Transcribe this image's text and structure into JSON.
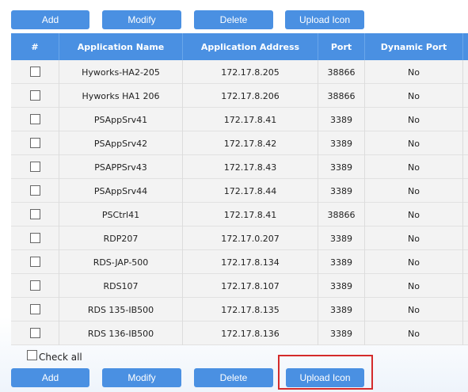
{
  "toolbar_top": {
    "add": "Add",
    "modify": "Modify",
    "delete": "Delete",
    "upload": "Upload Icon"
  },
  "toolbar_bottom": {
    "add": "Add",
    "modify": "Modify",
    "delete": "Delete",
    "upload": "Upload Icon"
  },
  "table": {
    "headers": [
      "#",
      "Application Name",
      "Application Address",
      "Port",
      "Dynamic Port"
    ],
    "rows": [
      [
        "Hyworks-HA2-205",
        "172.17.8.205",
        "38866",
        "No"
      ],
      [
        "Hyworks HA1 206",
        "172.17.8.206",
        "38866",
        "No"
      ],
      [
        "PSAppSrv41",
        "172.17.8.41",
        "3389",
        "No"
      ],
      [
        "PSAppSrv42",
        "172.17.8.42",
        "3389",
        "No"
      ],
      [
        "PSAPPSrv43",
        "172.17.8.43",
        "3389",
        "No"
      ],
      [
        "PSAppSrv44",
        "172.17.8.44",
        "3389",
        "No"
      ],
      [
        "PSCtrl41",
        "172.17.8.41",
        "38866",
        "No"
      ],
      [
        "RDP207",
        "172.17.0.207",
        "3389",
        "No"
      ],
      [
        "RDS-JAP-500",
        "172.17.8.134",
        "3389",
        "No"
      ],
      [
        "RDS107",
        "172.17.8.107",
        "3389",
        "No"
      ],
      [
        "RDS 135-IB500",
        "172.17.8.135",
        "3389",
        "No"
      ],
      [
        "RDS 136-IB500",
        "172.17.8.136",
        "3389",
        "No"
      ]
    ]
  },
  "check_all_label": "Check all",
  "colors": {
    "accent": "#4a90e2",
    "highlight": "#d42b2b"
  }
}
